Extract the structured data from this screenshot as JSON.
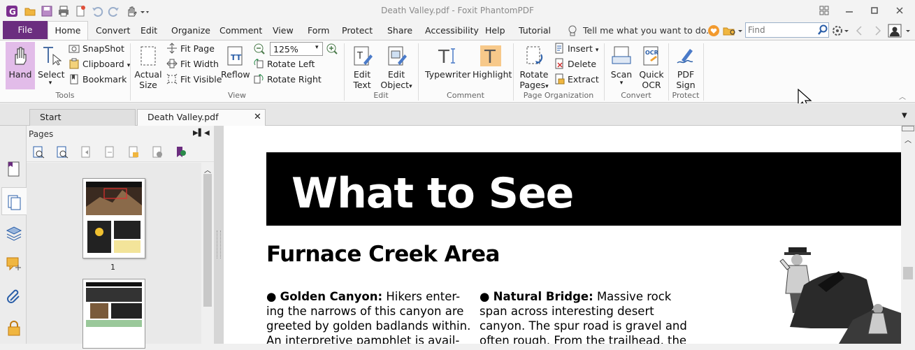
{
  "window": {
    "title": "Death Valley.pdf - Foxit PhantomPDF"
  },
  "quick_access": [
    {
      "icon": "foxit-logo-icon"
    },
    {
      "icon": "open-folder-icon"
    },
    {
      "icon": "save-icon"
    },
    {
      "icon": "print-icon"
    },
    {
      "icon": "new-icon"
    },
    {
      "icon": "undo-icon"
    },
    {
      "icon": "redo-icon"
    },
    {
      "icon": "hand-tool-icon"
    }
  ],
  "menu": {
    "file": "File",
    "tabs": [
      "Home",
      "Convert",
      "Edit",
      "Organize",
      "Comment",
      "View",
      "Form",
      "Protect",
      "Share",
      "Accessibility",
      "Help",
      "Tutorial"
    ],
    "tell_me": "Tell me what you want to do..",
    "find_placeholder": "Find"
  },
  "ribbon": {
    "tools": {
      "label": "Tools",
      "hand": "Hand",
      "select": "Select",
      "snapshot": "SnapShot",
      "clipboard": "Clipboard",
      "bookmark": "Bookmark"
    },
    "view": {
      "label": "View",
      "actual_size_1": "Actual",
      "actual_size_2": "Size",
      "fit_page": "Fit Page",
      "fit_width": "Fit Width",
      "fit_visible": "Fit Visible",
      "reflow": "Reflow",
      "zoom_value": "125%",
      "rotate_left": "Rotate Left",
      "rotate_right": "Rotate Right"
    },
    "edit": {
      "label": "Edit",
      "edit_text_1": "Edit",
      "edit_text_2": "Text",
      "edit_object_1": "Edit",
      "edit_object_2": "Object"
    },
    "comment": {
      "label": "Comment",
      "typewriter": "Typewriter",
      "highlight": "Highlight"
    },
    "page_org": {
      "label": "Page Organization",
      "rotate_pages_1": "Rotate",
      "rotate_pages_2": "Pages",
      "insert": "Insert",
      "delete": "Delete",
      "extract": "Extract"
    },
    "convert": {
      "label": "Convert",
      "scan": "Scan",
      "quick_ocr_1": "Quick",
      "quick_ocr_2": "OCR"
    },
    "protect": {
      "label": "Protect",
      "pdf_sign_1": "PDF",
      "pdf_sign_2": "Sign"
    }
  },
  "doc_tabs": [
    {
      "label": "Start"
    },
    {
      "label": "Death Valley.pdf"
    }
  ],
  "pages_panel": {
    "title": "Pages",
    "page_1_number": "1"
  },
  "document": {
    "banner": "What to See",
    "section": "Furnace Creek Area",
    "col1": {
      "bold": "Golden Canyon:",
      "lines": [
        "Hikers enter-",
        "ing the narrows of this canyon are",
        "greeted by golden badlands within.",
        "An interpretive pamphlet is avail-"
      ]
    },
    "col2": {
      "bold": "Natural Bridge:",
      "lines": [
        "Massive rock",
        "span across interesting desert",
        "canyon. The spur road is gravel and",
        "often rough. From the trailhead, the"
      ]
    }
  },
  "colors": {
    "file_tab": "#6b2d7f",
    "hand_active": "#e2bce9",
    "highlight_active": "#f7c98a"
  }
}
